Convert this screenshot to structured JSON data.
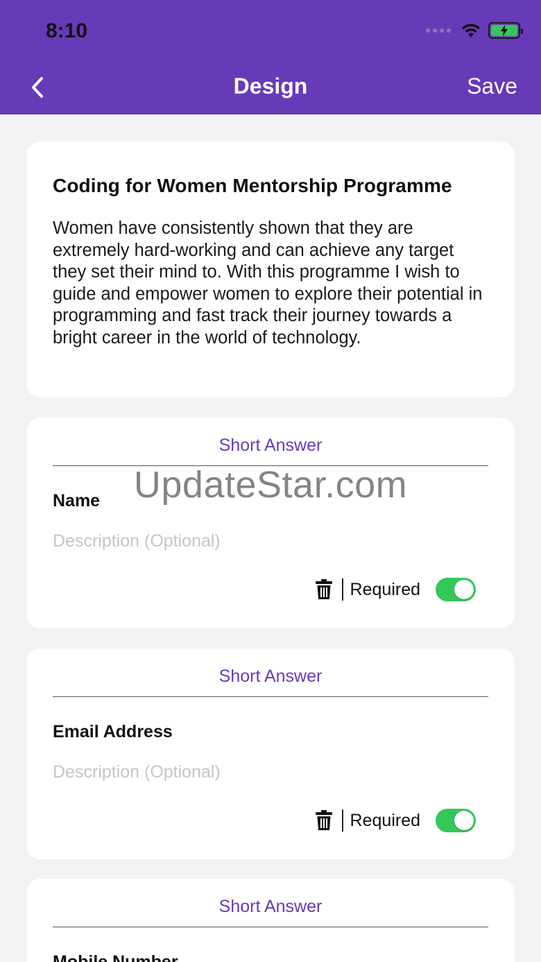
{
  "status_bar": {
    "time": "8:10"
  },
  "nav": {
    "title": "Design",
    "save_label": "Save"
  },
  "form": {
    "title": "Coding for Women Mentorship Programme",
    "description": "Women have consistently shown that they are extremely hard-working and can achieve any target they set their mind to. With this programme I wish to guide and empower women to explore their potential in programming and fast track their journey towards a bright career in the world of technology."
  },
  "questions": [
    {
      "type": "Short Answer",
      "label": "Name",
      "description_placeholder": "Description (Optional)",
      "required_label": "Required",
      "required": true
    },
    {
      "type": "Short Answer",
      "label": "Email Address",
      "description_placeholder": "Description (Optional)",
      "required_label": "Required",
      "required": true
    },
    {
      "type": "Short Answer",
      "label": "Mobile Number"
    }
  ],
  "watermark": "UpdateStar.com",
  "colors": {
    "accent": "#673ab7",
    "toggle_on": "#34c759"
  }
}
